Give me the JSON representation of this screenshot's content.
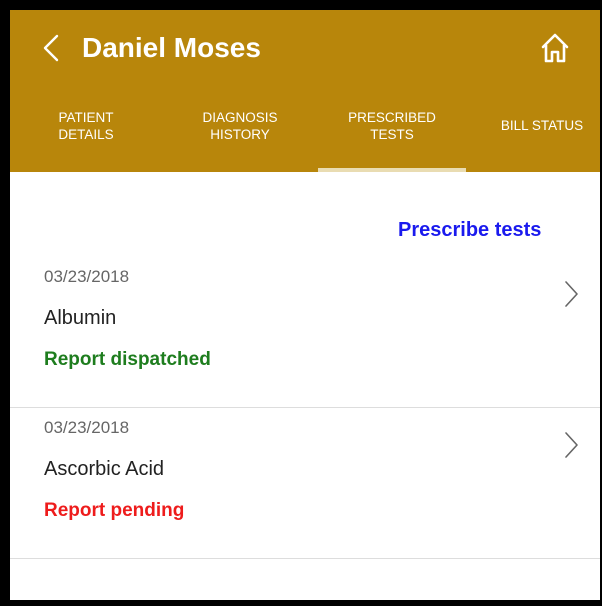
{
  "header": {
    "title": "Daniel Moses",
    "back_icon": "chevron-left-icon",
    "home_icon": "home-icon",
    "background_color": "#b8860b"
  },
  "tabs": [
    {
      "label": "PATIENT DETAILS",
      "active": false
    },
    {
      "label": "DIAGNOSIS HISTORY",
      "active": false
    },
    {
      "label": "PRESCRIBED TESTS",
      "active": true
    },
    {
      "label": "BILL STATUS",
      "active": false
    }
  ],
  "actions": {
    "prescribe_label": "Prescribe tests",
    "prescribe_color": "#1a1aee"
  },
  "tests": [
    {
      "date": "03/23/2018",
      "name": "Albumin",
      "status": "Report dispatched",
      "status_color": "#1e7d1e"
    },
    {
      "date": "03/23/2018",
      "name": "Ascorbic Acid",
      "status": "Report pending",
      "status_color": "#ee1c1c"
    }
  ]
}
